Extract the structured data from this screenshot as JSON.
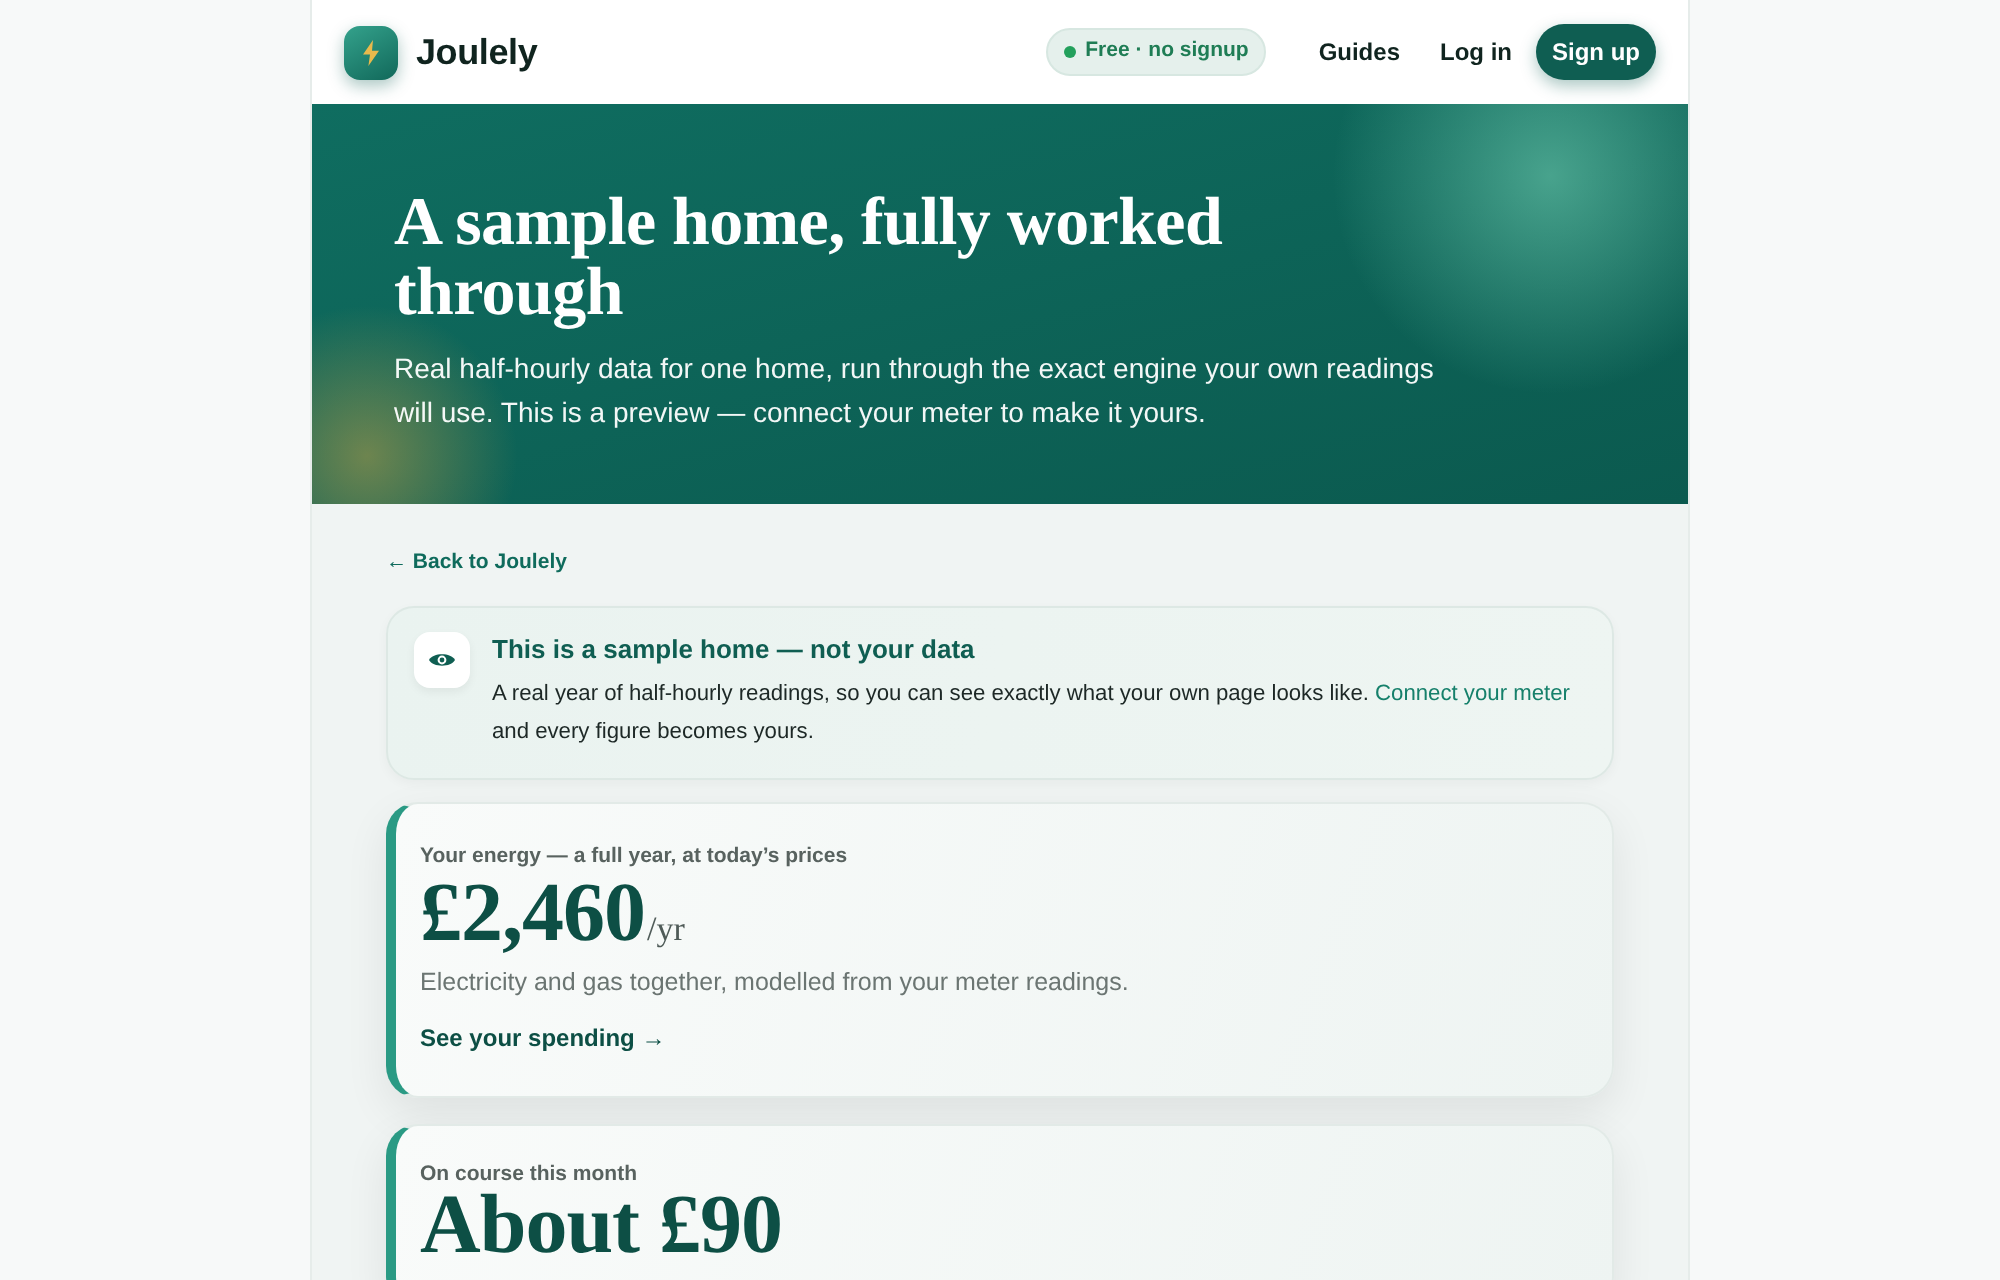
{
  "header": {
    "logo_text": "Joulely",
    "badge": "Free · no signup",
    "nav": [
      {
        "label": "Guides"
      },
      {
        "label": "Log in"
      }
    ],
    "cta": "Sign up"
  },
  "hero": {
    "title": "A sample home, fully worked through",
    "subtitle": "Real half-hourly data for one home, run through the exact engine your own readings will use. This is a preview — connect your meter to make it yours."
  },
  "back_link": "← Back to Joulely",
  "notice": {
    "title": "This is a sample home — not your data",
    "body": "A real year of half-hourly readings, so you can see exactly what your own page looks like.",
    "link": "Connect your meter",
    "body_end": "and every figure becomes yours."
  },
  "cards": [
    {
      "label": "Your energy — a full year, at today’s prices",
      "value": "£2,460",
      "unit": "/yr",
      "description": "Electricity and gas together, modelled from your meter readings.",
      "link": "See your spending →"
    },
    {
      "label": "On course this month",
      "value": "About £90"
    }
  ]
}
